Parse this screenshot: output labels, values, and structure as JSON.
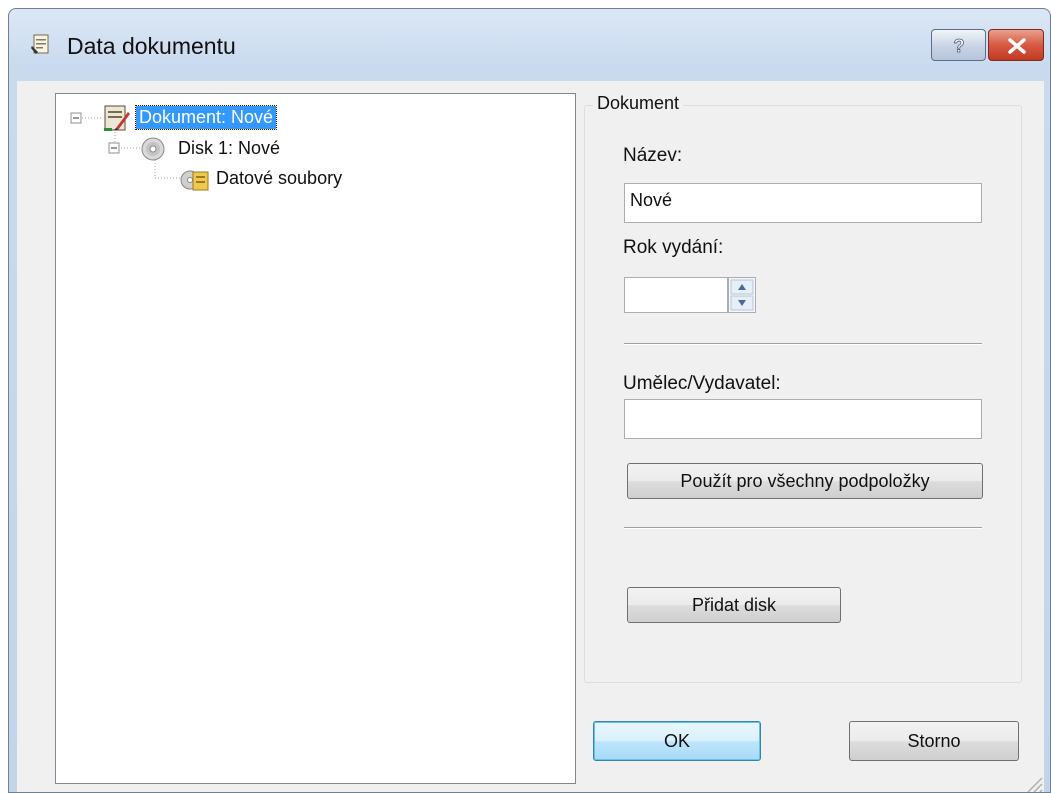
{
  "window": {
    "title": "Data dokumentu"
  },
  "tree": {
    "items": [
      {
        "label": "Dokument: Nové",
        "icon": "document-pen-icon",
        "selected": true
      },
      {
        "label": "Disk 1: Nové",
        "icon": "disc-icon"
      },
      {
        "label": "Datové soubory",
        "icon": "data-files-icon"
      }
    ]
  },
  "panel": {
    "group_title": "Dokument",
    "name_label": "Název:",
    "name_value": "Nové",
    "year_label": "Rok vydání:",
    "year_value": "",
    "artist_label": "Umělec/Vydavatel:",
    "artist_value": "",
    "apply_all_button": "Použít pro všechny podpoložky",
    "add_disc_button": "Přidat disk"
  },
  "footer": {
    "ok_button": "OK",
    "cancel_button": "Storno"
  },
  "colors": {
    "selection": "#3399ff",
    "close": "#d75a42"
  }
}
